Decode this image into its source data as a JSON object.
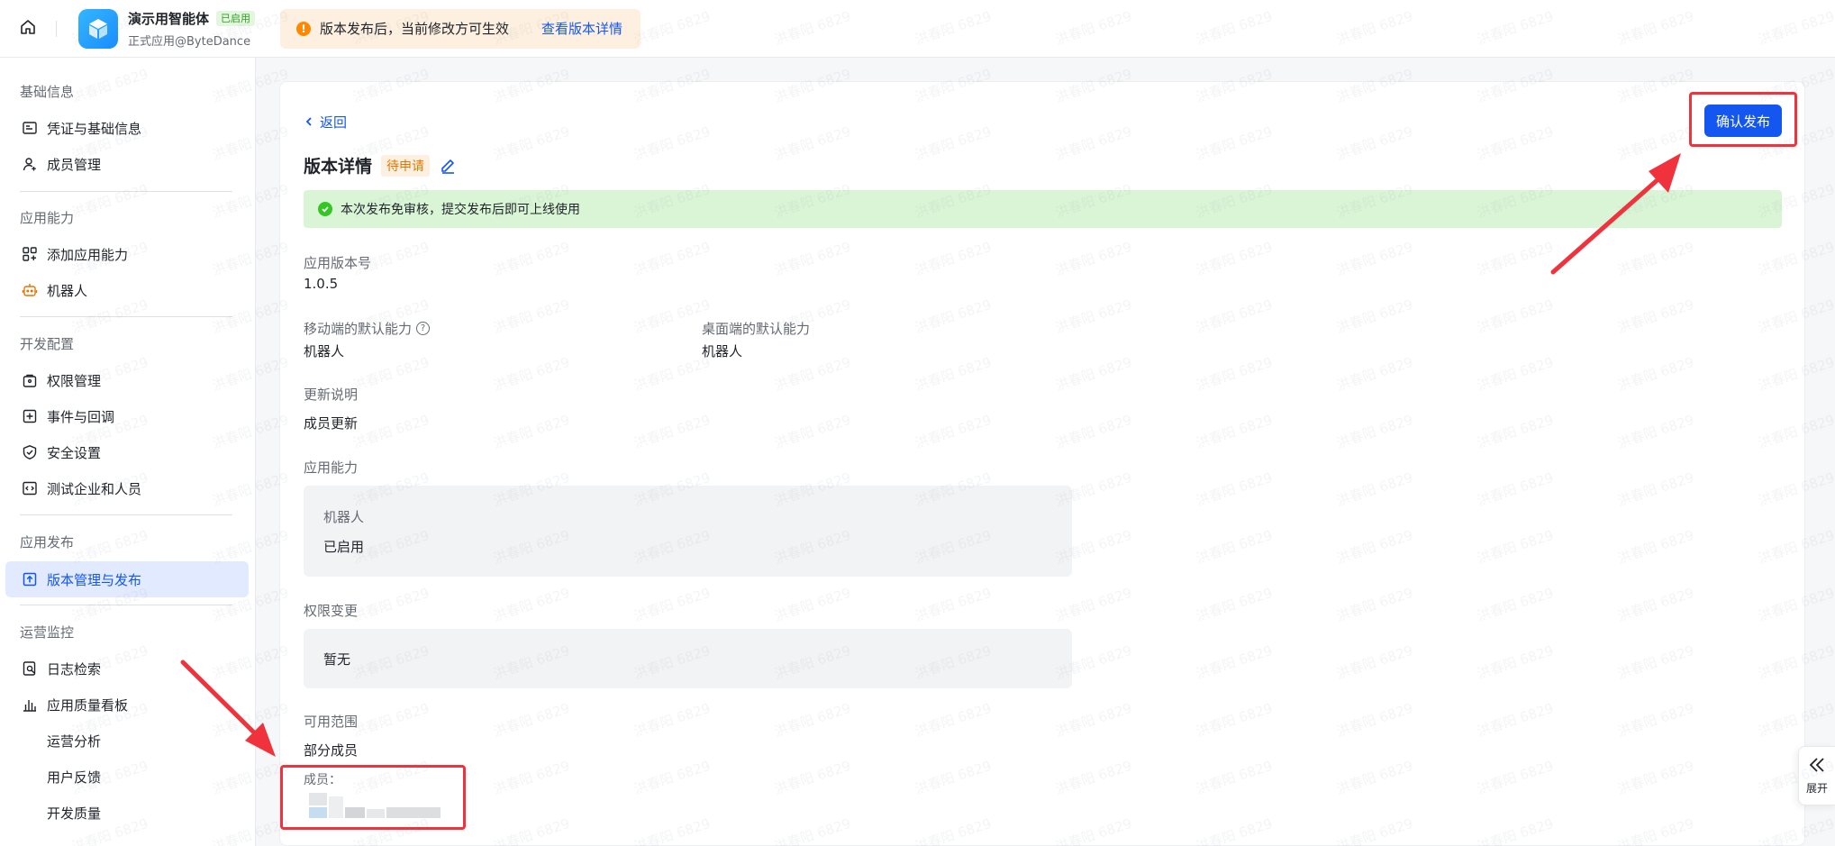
{
  "topbar": {
    "app_name": "演示用智能体",
    "app_status_badge": "已启用",
    "app_subtitle": "正式应用@ByteDance",
    "notice_text": "版本发布后，当前修改方可生效",
    "notice_link": "查看版本详情"
  },
  "sidebar": {
    "groups": [
      {
        "title": "基础信息",
        "items": [
          {
            "label": "凭证与基础信息",
            "icon": "id-card-icon"
          },
          {
            "label": "成员管理",
            "icon": "user-add-icon"
          }
        ]
      },
      {
        "title": "应用能力",
        "items": [
          {
            "label": "添加应用能力",
            "icon": "grid-plus-icon"
          },
          {
            "label": "机器人",
            "icon": "robot-icon"
          }
        ]
      },
      {
        "title": "开发配置",
        "items": [
          {
            "label": "权限管理",
            "icon": "lock-bag-icon"
          },
          {
            "label": "事件与回调",
            "icon": "event-plus-icon"
          },
          {
            "label": "安全设置",
            "icon": "shield-icon"
          },
          {
            "label": "测试企业和人员",
            "icon": "code-box-icon"
          }
        ]
      },
      {
        "title": "应用发布",
        "items": [
          {
            "label": "版本管理与发布",
            "icon": "upload-box-icon",
            "active": true
          }
        ]
      },
      {
        "title": "运营监控",
        "items": [
          {
            "label": "日志检索",
            "icon": "log-search-icon"
          },
          {
            "label": "应用质量看板",
            "icon": "bar-chart-icon"
          },
          {
            "label": "运营分析"
          },
          {
            "label": "用户反馈"
          },
          {
            "label": "开发质量"
          }
        ]
      }
    ]
  },
  "main": {
    "back_label": "返回",
    "confirm_button": "确认发布",
    "title": "版本详情",
    "status_tag": "待申请",
    "success_message": "本次发布免审核，提交发布后即可上线使用",
    "fields": {
      "version_label": "应用版本号",
      "version_value": "1.0.5",
      "mobile_default_label": "移动端的默认能力",
      "mobile_default_value": "机器人",
      "desktop_default_label": "桌面端的默认能力",
      "desktop_default_value": "机器人",
      "update_notes_label": "更新说明",
      "update_notes_value": "成员更新",
      "capabilities_label": "应用能力",
      "capability_name": "机器人",
      "capability_status": "已启用",
      "permission_change_label": "权限变更",
      "permission_change_value": "暂无",
      "scope_label": "可用范围",
      "scope_value": "部分成员",
      "members_label": "成员："
    }
  },
  "expand_tab": {
    "label": "展开"
  },
  "watermark_text": "洪春阳 6829",
  "colors": {
    "primary": "#1456f0",
    "success_bg": "#d9f5d6",
    "warning": "#ff8800",
    "annotation_red": "#f0323c"
  }
}
